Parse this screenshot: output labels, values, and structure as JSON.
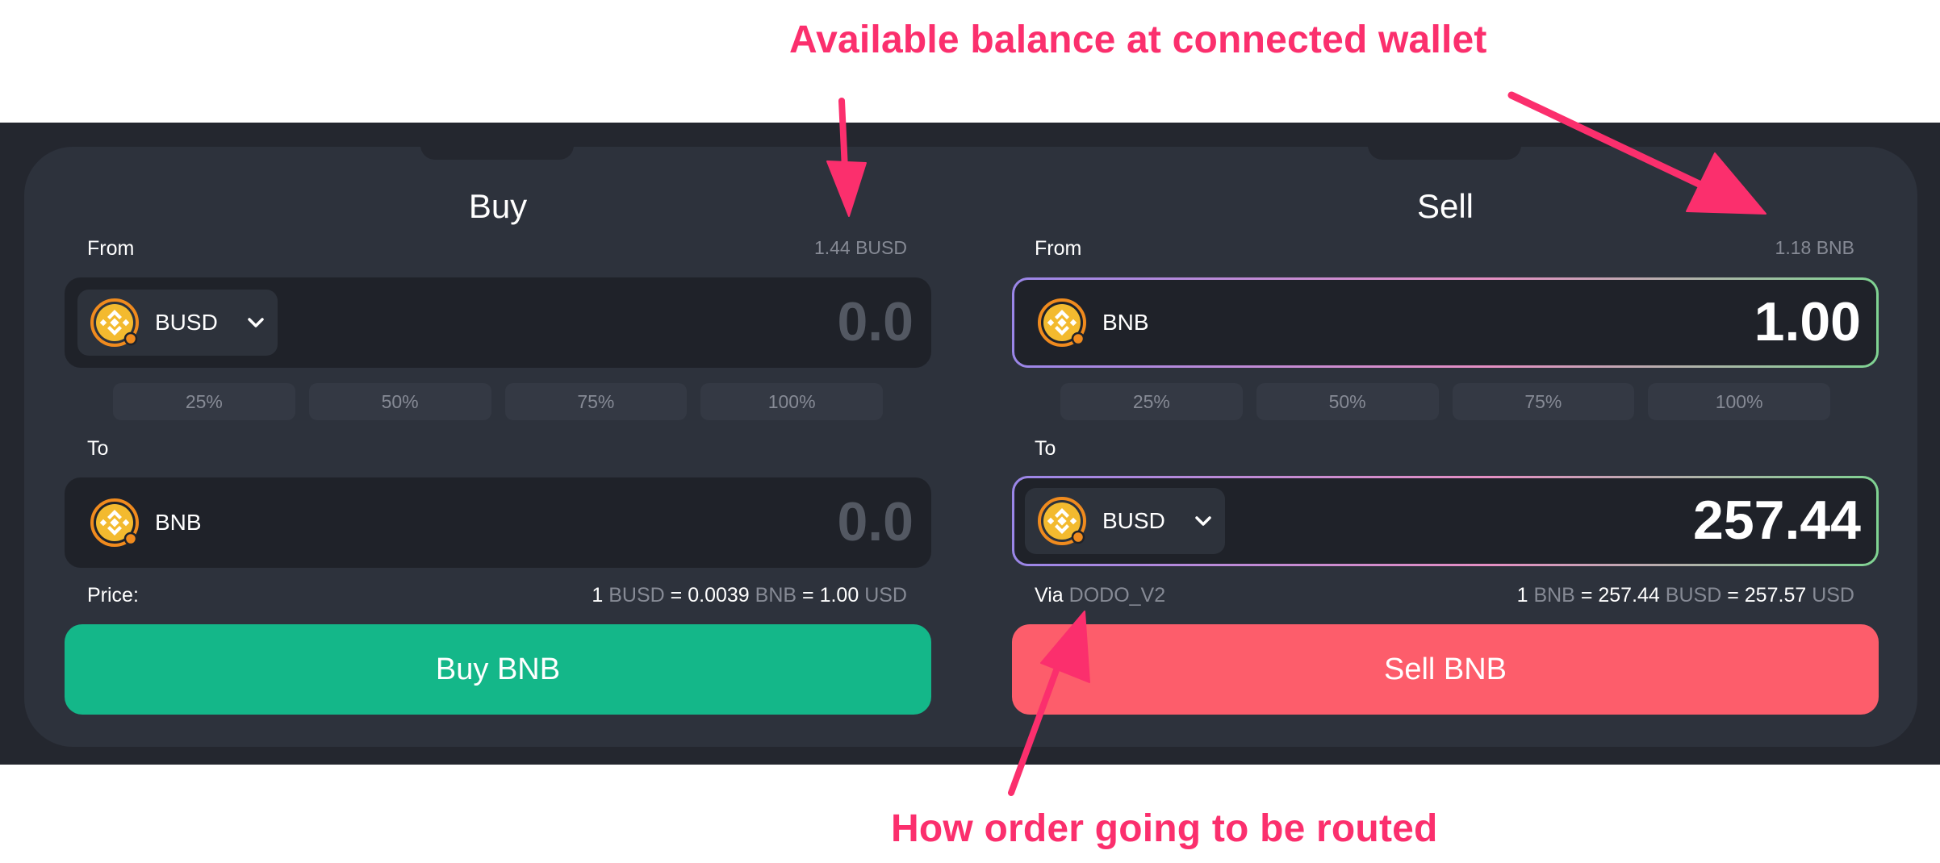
{
  "annotations": {
    "balance": "Available balance at connected wallet",
    "route": "How order going to be routed"
  },
  "buy": {
    "title": "Buy",
    "from_label": "From",
    "from_balance": "1.44 BUSD",
    "from_token": "BUSD",
    "from_amount": "0.0",
    "percent_options": [
      "25%",
      "50%",
      "75%",
      "100%"
    ],
    "to_label": "To",
    "to_token": "BNB",
    "to_amount": "0.0",
    "price_label": "Price:",
    "rate": {
      "a": "1",
      "a_unit": "BUSD",
      "eq1": "=",
      "b": "0.0039",
      "b_unit": "BNB",
      "eq2": "=",
      "c": "1.00",
      "c_unit": "USD"
    },
    "button": "Buy BNB"
  },
  "sell": {
    "title": "Sell",
    "from_label": "From",
    "from_balance": "1.18 BNB",
    "from_token": "BNB",
    "from_amount": "1.00",
    "percent_options": [
      "25%",
      "50%",
      "75%",
      "100%"
    ],
    "to_label": "To",
    "to_token": "BUSD",
    "to_amount": "257.44",
    "via_label": "Via",
    "via_route": "DODO_V2",
    "rate": {
      "a": "1",
      "a_unit": "BNB",
      "eq1": "=",
      "b": "257.44",
      "b_unit": "BUSD",
      "eq2": "=",
      "c": "257.57",
      "c_unit": "USD"
    },
    "button": "Sell BNB"
  },
  "icons": {
    "token": "binance-coin-icon",
    "dropdown": "chevron-down-icon"
  },
  "colors": {
    "background_band": "#24272f",
    "panel": "#2d323c",
    "buy_button": "#14b789",
    "sell_button": "#fd5d6b",
    "annotation": "#fb2f6d",
    "coin": "#f3ba2f"
  }
}
